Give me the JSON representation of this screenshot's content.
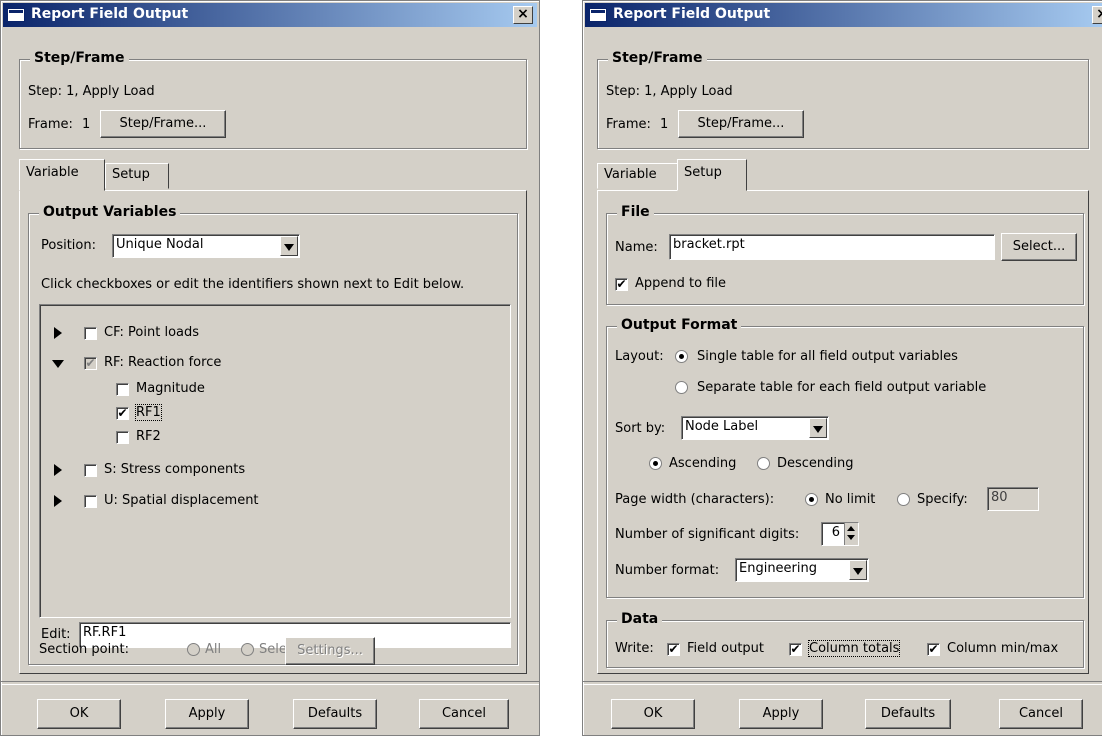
{
  "left": {
    "title": "Report Field Output",
    "step_frame": {
      "group_title": "Step/Frame",
      "step_text": "Step: 1, Apply Load",
      "frame_label": "Frame:",
      "frame_value": "1",
      "button_label": "Step/Frame..."
    },
    "tabs": [
      "Variable",
      "Setup"
    ],
    "output_vars": {
      "group_title": "Output Variables",
      "position_label": "Position:",
      "position_value": "Unique Nodal",
      "instruction": "Click checkboxes or edit the identifiers shown next to Edit below.",
      "tree": [
        {
          "label": "CF: Point loads",
          "expanded": false,
          "checked": false
        },
        {
          "label": "RF: Reaction force",
          "expanded": true,
          "checked": true
        },
        {
          "label": "Magnitude",
          "checked": false
        },
        {
          "label": "RF1",
          "checked": true
        },
        {
          "label": "RF2",
          "checked": false
        },
        {
          "label": "S: Stress components",
          "expanded": false,
          "checked": false
        },
        {
          "label": "U: Spatial displacement",
          "expanded": false,
          "checked": false
        }
      ],
      "edit_label": "Edit:",
      "edit_value": "RF.RF1",
      "section_label": "Section point:",
      "section_all": "All",
      "section_select": "Select",
      "settings_label": "Settings..."
    },
    "buttons": [
      "OK",
      "Apply",
      "Defaults",
      "Cancel"
    ]
  },
  "right": {
    "title": "Report Field Output",
    "step_frame": {
      "group_title": "Step/Frame",
      "step_text": "Step: 1, Apply Load",
      "frame_label": "Frame:",
      "frame_value": "1",
      "button_label": "Step/Frame..."
    },
    "tabs": [
      "Variable",
      "Setup"
    ],
    "file": {
      "group_title": "File",
      "name_label": "Name:",
      "name_value": "bracket.rpt",
      "select_label": "Select...",
      "append_label": "Append to file",
      "append_checked": true
    },
    "output_format": {
      "group_title": "Output Format",
      "layout_label": "Layout:",
      "layout_single": "Single table for all field output variables",
      "layout_separate": "Separate table for each field output variable",
      "layout_selected": "single",
      "sort_label": "Sort by:",
      "sort_value": "Node Label",
      "ascending": "Ascending",
      "descending": "Descending",
      "order_selected": "ascending",
      "page_width_label": "Page width (characters):",
      "no_limit": "No limit",
      "specify": "Specify:",
      "specify_value": "80",
      "digits_label": "Number of significant digits:",
      "digits_value": "6",
      "number_format_label": "Number format:",
      "number_format_value": "Engineering"
    },
    "data": {
      "group_title": "Data",
      "write_label": "Write:",
      "field_output": "Field output",
      "column_totals": "Column totals",
      "column_minmax": "Column min/max"
    },
    "buttons": [
      "OK",
      "Apply",
      "Defaults",
      "Cancel"
    ]
  },
  "icons": {
    "close": "×",
    "check": "✔"
  }
}
